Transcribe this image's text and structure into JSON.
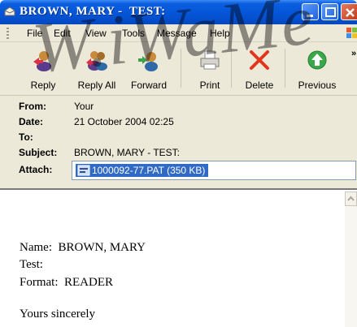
{
  "window": {
    "title": "BROWN, MARY -  TEST:"
  },
  "menu": {
    "items": [
      "File",
      "Edit",
      "View",
      "Tools",
      "Message",
      "Help"
    ]
  },
  "toolbar": {
    "buttons": [
      "Reply",
      "Reply All",
      "Forward",
      "Print",
      "Delete",
      "Previous"
    ]
  },
  "header": {
    "from_label": "From:",
    "from_value": "Your",
    "date_label": "Date:",
    "date_value": "21 October 2004 02:25",
    "to_label": "To:",
    "to_value": "",
    "subject_label": "Subject:",
    "subject_value": "BROWN, MARY -  TEST:",
    "attach_label": "Attach:",
    "attachment": "1000092-77.PAT (350 KB)"
  },
  "message": {
    "name_line": "Name:  BROWN, MARY",
    "test_line": "Test:",
    "format_line": "Format:  READER",
    "closing": "Yours sincerely"
  },
  "watermark": "W.iWaMe"
}
